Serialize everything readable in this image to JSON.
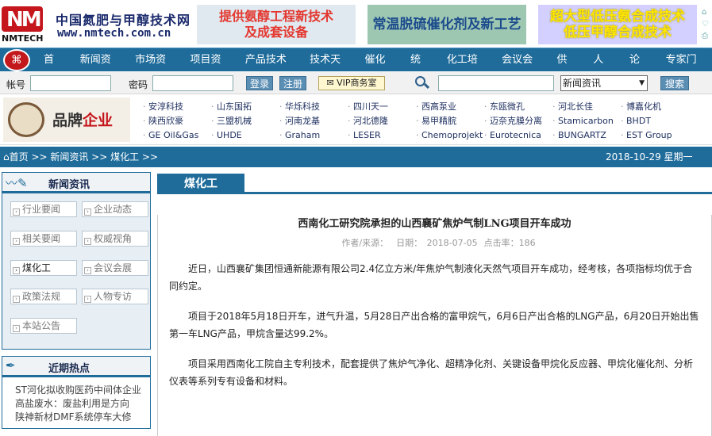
{
  "header": {
    "logo_text": "NMTECH",
    "logo_mark": "NM",
    "site_name": "中国氮肥与甲醇技术网",
    "site_url": "www.nmtech.com.cn",
    "banners": [
      {
        "line1": "提供氨醇工程新技术",
        "line2": "及成套设备"
      },
      {
        "line1": "常温脱硫催化剂及新工艺",
        "line2": ""
      },
      {
        "line1": "超大型低压氨合成技术",
        "line2": "低压甲醇合成技术"
      }
    ],
    "side_icons": [
      "home-icon",
      "bookmark-icon",
      "print-icon"
    ]
  },
  "nav": {
    "items": [
      "首页",
      "新闻资讯",
      "市场资讯",
      "项目资讯",
      "产品技术库",
      "技术天地",
      "催化剂",
      "统计",
      "化工培训",
      "会议会展",
      "供求",
      "人才",
      "论坛",
      "专家门诊"
    ]
  },
  "login": {
    "account_label": "帐号",
    "password_label": "密码",
    "login_button": "登录",
    "register_button": "注册",
    "vip_button": "VIP商务室",
    "search_select_value": "新闻资讯",
    "search_button": "搜索"
  },
  "brands": {
    "title_black": "品牌",
    "title_red": "企业",
    "items": [
      "安淳科技",
      "山东国拓",
      "华烁科技",
      "四川天一",
      "西高泵业",
      "东瓯微孔",
      "河北长佳",
      "博嘉化机",
      "陕西欣豪",
      "三盟机械",
      "河南龙基",
      "河北德隆",
      "易甲精脘",
      "迈奈克膜分离",
      "Stamicarbon",
      "BHDT",
      "GE Oil&Gas",
      "UHDE",
      "Graham",
      "LESER",
      "Chemoprojekt",
      "Eurotecnica",
      "BUNGARTZ",
      "EST Group"
    ]
  },
  "breadcrumb": {
    "path": "首页 >> 新闻资讯 >> 煤化工 >>",
    "date": "2018-10-29 星期一"
  },
  "sidebar": {
    "news_title": "新闻资讯",
    "categories": [
      {
        "label": "行业要闻",
        "active": false
      },
      {
        "label": "企业动态",
        "active": false
      },
      {
        "label": "相关要闻",
        "active": false
      },
      {
        "label": "权威视角",
        "active": false
      },
      {
        "label": "煤化工",
        "active": true
      },
      {
        "label": "会议会展",
        "active": false
      },
      {
        "label": "政策法规",
        "active": false
      },
      {
        "label": "人物专访",
        "active": false
      },
      {
        "label": "本站公告",
        "active": false
      }
    ],
    "hot_title": "近期热点",
    "hot_items": [
      "ST河化拟收购医药中间体企业",
      "高盐废水：废盐利用是方向",
      "陕神新材DMF系统停车大修"
    ]
  },
  "main": {
    "tab_label": "煤化工",
    "article": {
      "title": "西南化工研究院承担的山西襄矿焦炉气制LNG项目开车成功",
      "author_label": "作者/来源：",
      "date_label": "日期：",
      "date": "2018-07-05",
      "clicks_label": "点击率：",
      "clicks": "186",
      "paragraphs": [
        "近日，山西襄矿集团恒通新能源有限公司2.4亿立方米/年焦炉气制液化天然气项目开车成功，经考核，各项指标均优于合同约定。",
        "项目于2018年5月18日开车，进气升温，5月28日产出合格的富甲烷气，6月6日产出合格的LNG产品，6月20日开始出售第一车LNG产品，甲烷含量达99.2%。",
        "项目采用西南化工院自主专利技术，配套提供了焦炉气净化、超精净化剂、关键设备甲烷化反应器、甲烷化催化剂、分析仪表等系列专有设备和材料。"
      ]
    }
  }
}
